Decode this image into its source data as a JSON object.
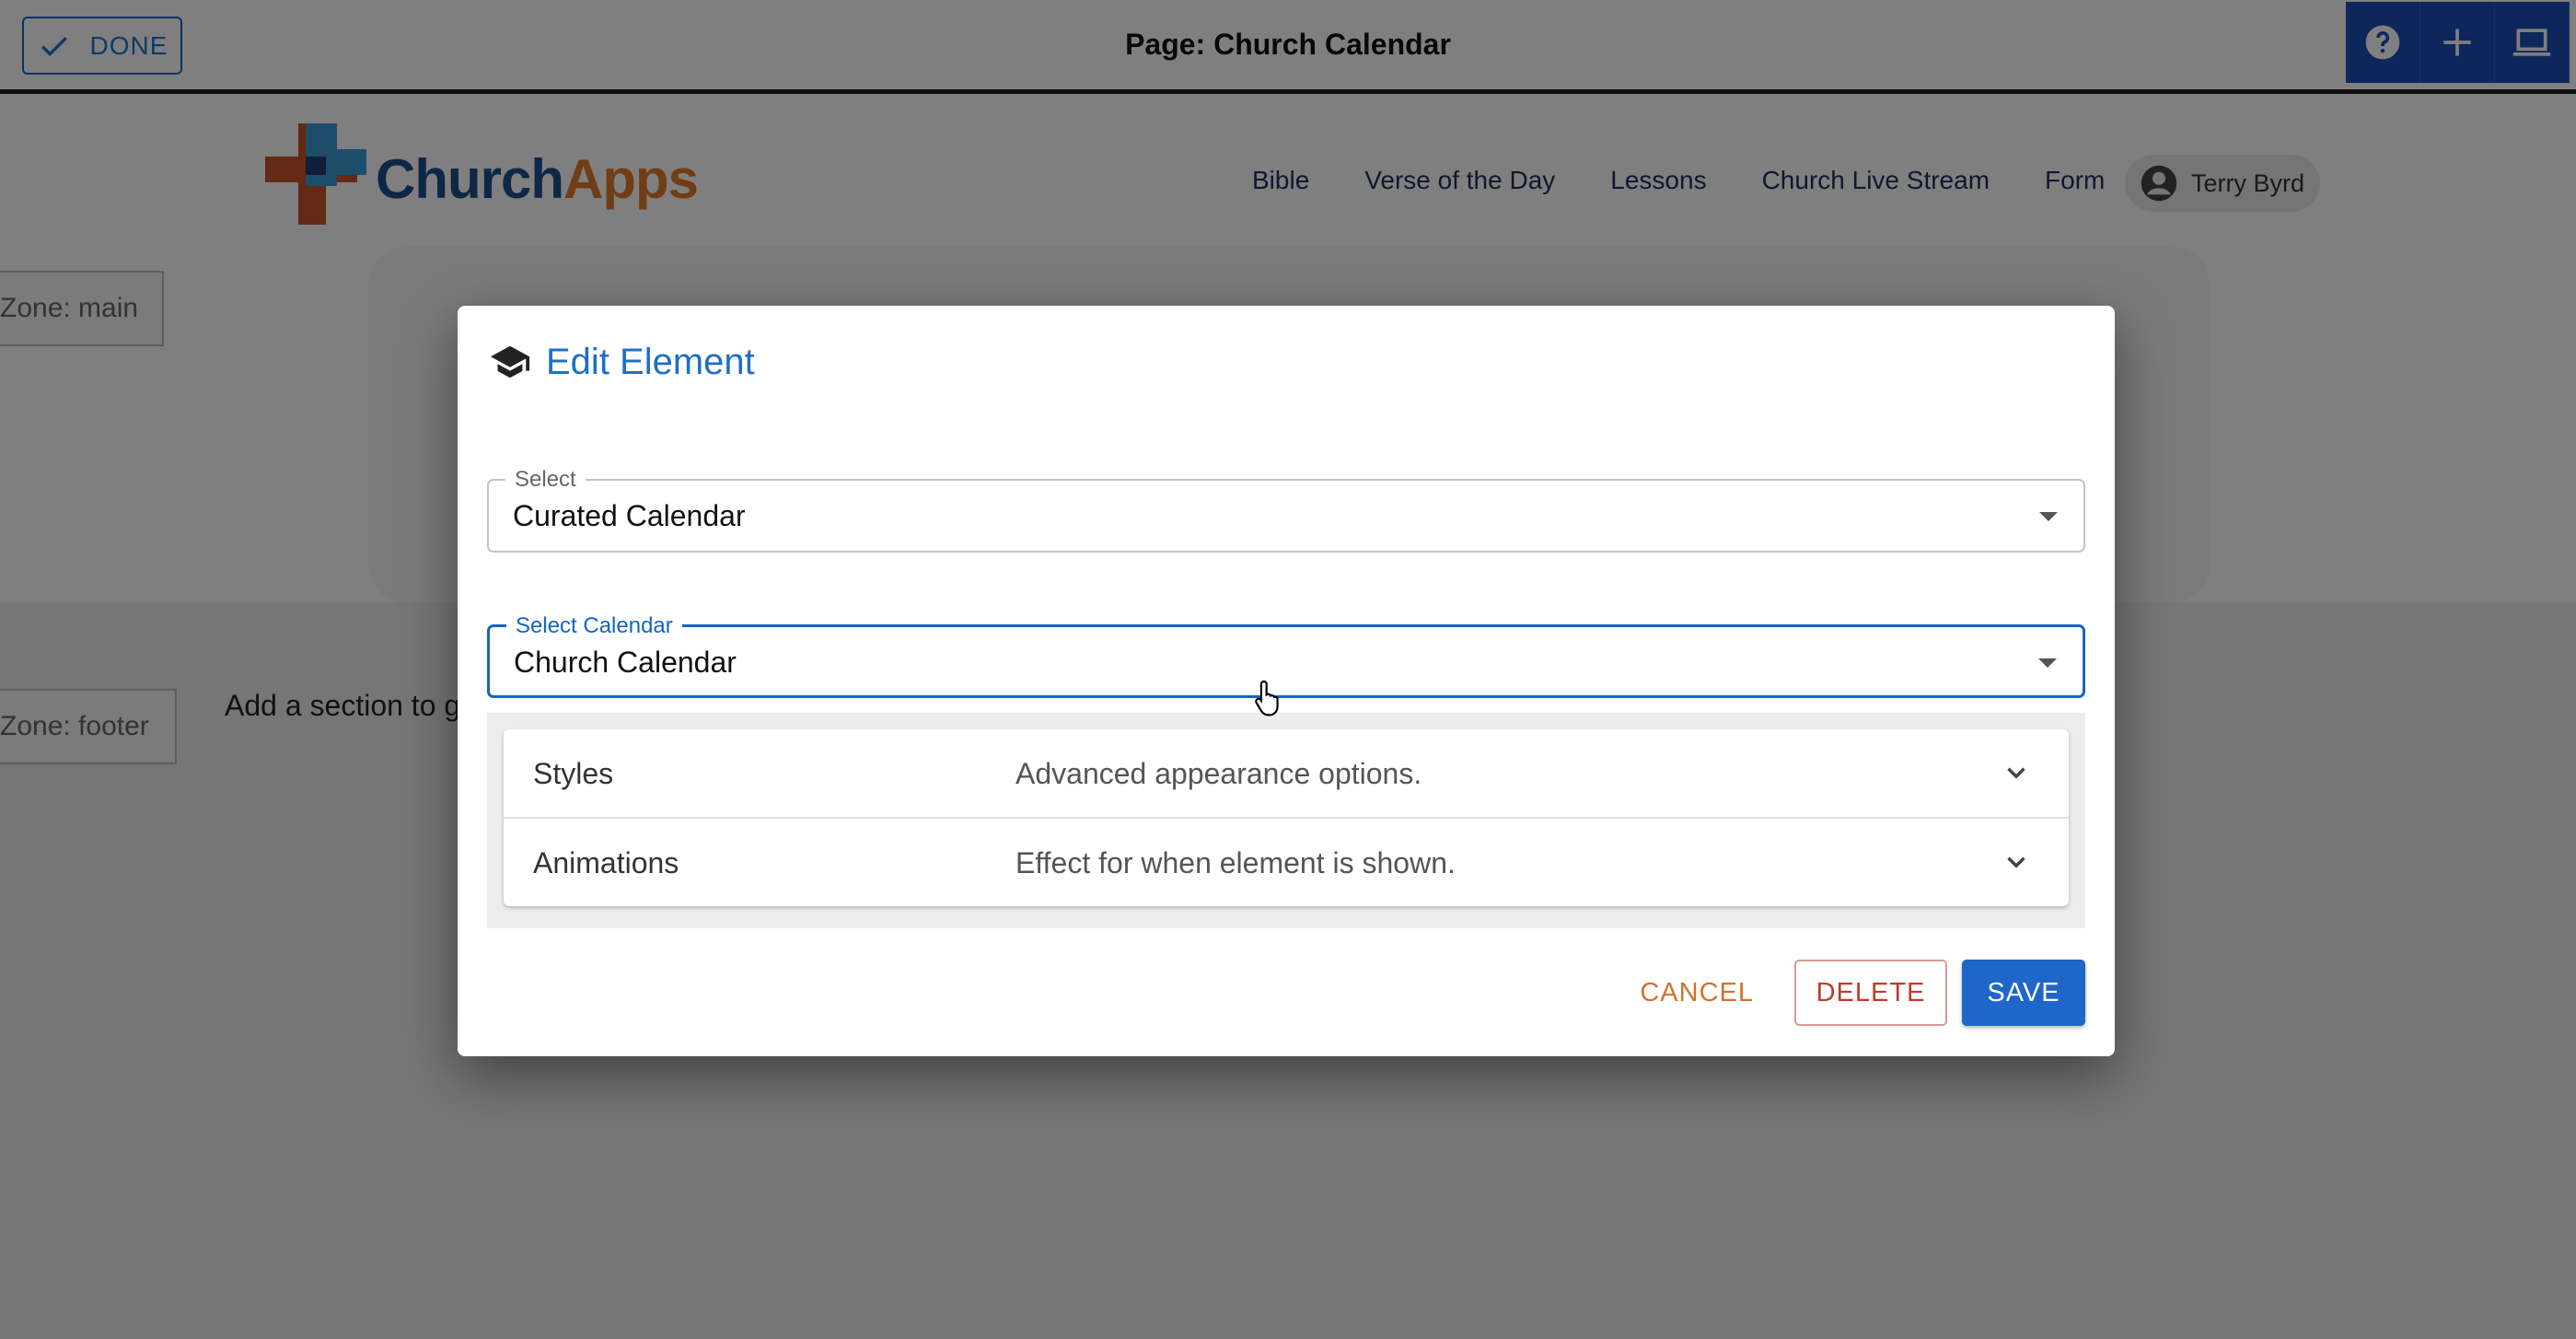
{
  "editor_bar": {
    "done_label": "DONE",
    "page_title": "Page: Church Calendar",
    "tools": [
      "help-icon",
      "add-icon",
      "laptop-icon"
    ]
  },
  "site": {
    "logo": {
      "church": "Church",
      "apps": "Apps"
    },
    "nav": [
      "Bible",
      "Verse of the Day",
      "Lessons",
      "Church Live Stream",
      "Form"
    ],
    "user": "Terry Byrd",
    "zone_main": "Zone: main",
    "zone_footer": "Zone: footer",
    "footer_text": "Add a section to g"
  },
  "dialog": {
    "title": "Edit Element",
    "select": {
      "label": "Select",
      "value": "Curated Calendar"
    },
    "calendar": {
      "label": "Select Calendar",
      "value": "Church Calendar"
    },
    "accordion": [
      {
        "title": "Styles",
        "description": "Advanced appearance options."
      },
      {
        "title": "Animations",
        "description": "Effect for when element is shown."
      }
    ],
    "buttons": {
      "cancel": "CANCEL",
      "delete": "DELETE",
      "save": "SAVE"
    }
  },
  "colors": {
    "primary": "#1f66c9",
    "accent": "#e07a2e",
    "delete": "#c0392b"
  }
}
